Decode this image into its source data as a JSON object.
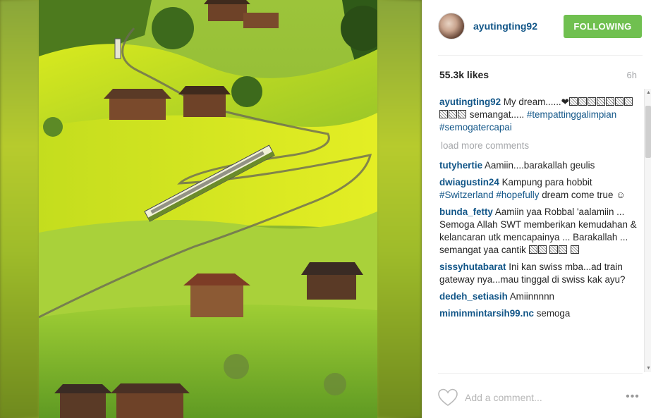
{
  "post": {
    "image_alt": "",
    "username": "ayutingting92",
    "follow_button": "FOLLOWING",
    "likes": "55.3k likes",
    "time": "6h",
    "caption": {
      "username": "ayutingting92",
      "text_part1": "My dream......❤",
      "text_part2": "semangat..... ",
      "hashtag1": "#tempattinggalimpian",
      "hashtag2": "#semogatercapai"
    },
    "load_more": "load more comments",
    "comments": [
      {
        "user": "tutyhertie",
        "text": "Aamiin....barakallah geulis"
      },
      {
        "user": "dwiagustin24",
        "text": "Kampung para hobbit ",
        "tag1": "#Switzerland",
        "tag2": "#hopefully",
        "text_after": " dream come true ☺"
      },
      {
        "user": "bunda_fetty",
        "text": "Aamiin yaa Robbal 'aalamiin ... Semoga Allah SWT memberikan kemudahan & kelancaran utk mencapainya ... Barakallah ... semangat yaa cantik "
      },
      {
        "user": "sissyhutabarat",
        "text": "Ini kan swiss mba...ad train gateway nya...mau tinggal di swiss kak ayu?"
      },
      {
        "user": "dedeh_setiasih",
        "text": "Amiinnnnn"
      },
      {
        "user": "miminmintarsih99.nc",
        "text": "semoga"
      }
    ],
    "add_comment_placeholder": "Add a comment...",
    "more_icon": "•••"
  },
  "colors": {
    "username": "#125688",
    "follow_bg": "#70c050",
    "muted": "#a5a7aa"
  },
  "icons": [
    "heart-icon",
    "more-options-icon",
    "scroll-up-icon",
    "scroll-down-icon"
  ]
}
